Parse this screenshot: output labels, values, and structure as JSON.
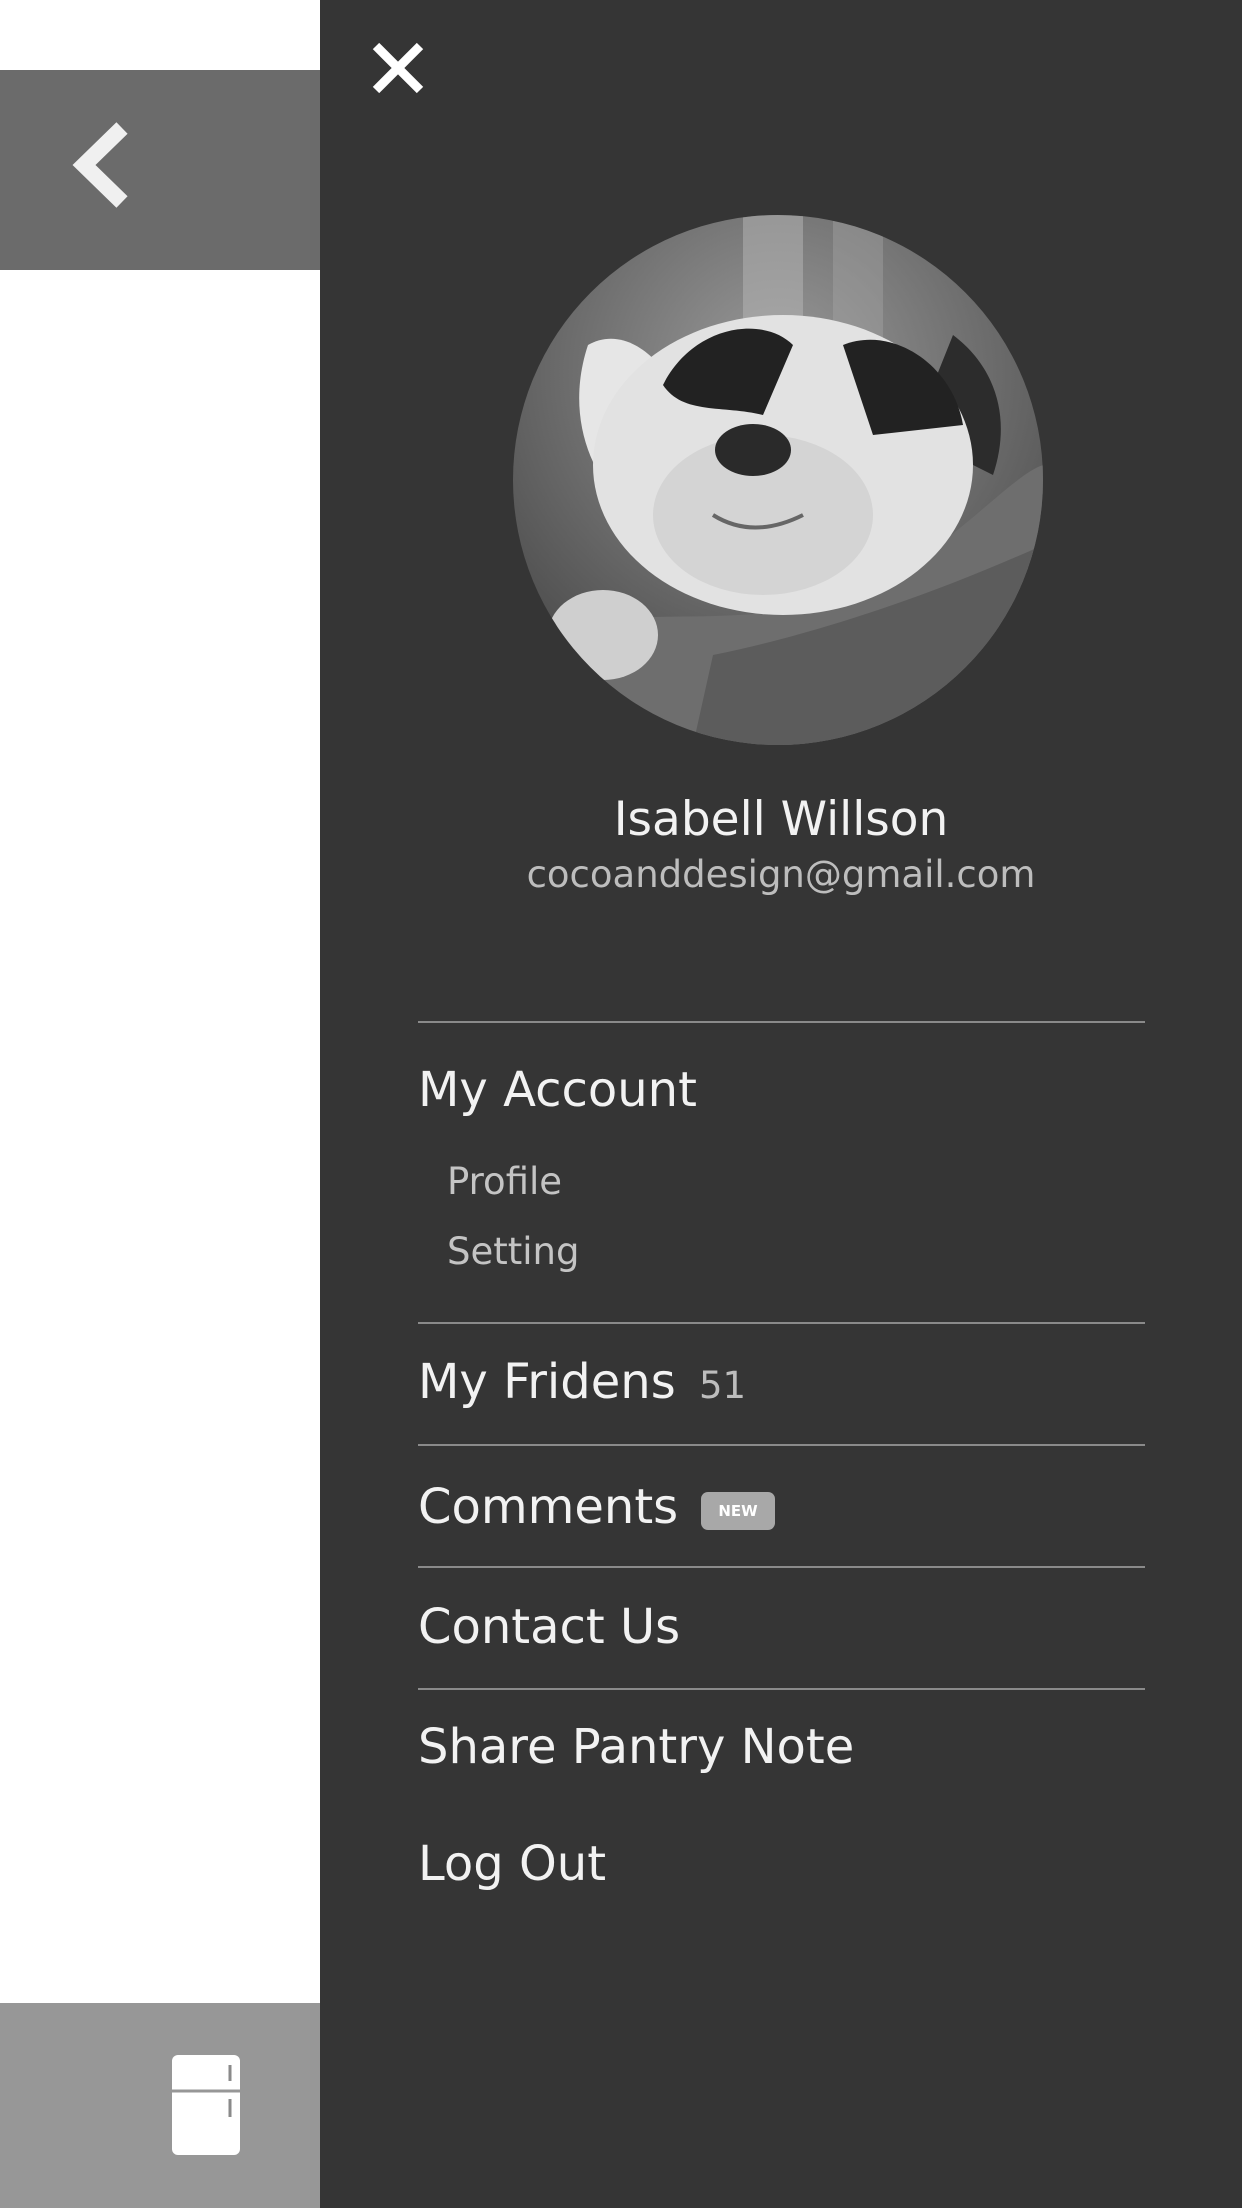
{
  "underlying_app": {
    "back_icon": "chevron-left-icon",
    "pantry_icon": "fridge-icon"
  },
  "drawer": {
    "close_icon": "close-icon",
    "user": {
      "name": "Isabell Willson",
      "email": "cocoanddesign@gmail.com",
      "avatar": "puppy-avatar"
    },
    "menu": {
      "my_account": {
        "label": "My Account",
        "sub_items": [
          "Profile",
          "Setting"
        ]
      },
      "my_friends": {
        "label": "My Fridens",
        "count": "51"
      },
      "comments": {
        "label": "Comments",
        "badge": "NEW"
      },
      "contact_us": {
        "label": "Contact Us"
      },
      "share_pantry_note": {
        "label": "Share Pantry Note"
      },
      "log_out": {
        "label": "Log Out"
      }
    }
  },
  "colors": {
    "drawer_bg": "#353535",
    "header_bg": "#6b6b6b",
    "footer_bg": "#979797",
    "badge_bg": "#a8a8a8"
  }
}
